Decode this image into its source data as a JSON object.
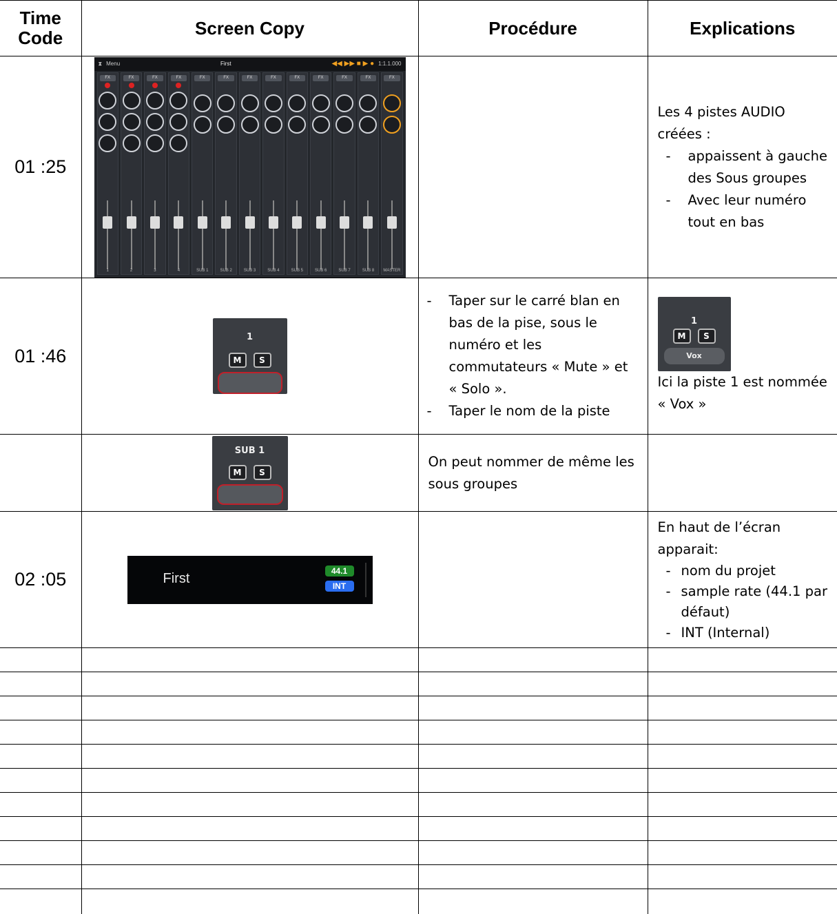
{
  "headers": {
    "time_code": "Time Code",
    "screen_copy": "Screen Copy",
    "procedure": "Procédure",
    "explications": "Explications"
  },
  "rows": [
    {
      "time": "01 :25",
      "screen": {
        "type": "mixer",
        "title": "First",
        "menu": "Menu",
        "counter": "1:1.1.000",
        "strip_labels": [
          "1",
          "2",
          "3",
          "4",
          "SUB 1",
          "SUB 2",
          "SUB 3",
          "SUB 4",
          "SUB 5",
          "SUB 6",
          "SUB 7",
          "SUB 8",
          "MASTER"
        ]
      },
      "procedure": [],
      "explication_intro": "Les 4 pistes AUDIO créées :",
      "explication_items": [
        "appaissent à gauche des Sous groupes",
        "Avec leur numéro tout en bas"
      ]
    },
    {
      "time": "01 :46",
      "screen": {
        "type": "track",
        "number": "1",
        "mute": "M",
        "solo": "S"
      },
      "procedure": [
        "Taper sur le carré blan en bas de la pise, sous le numéro et les commutateurs « Mute » et « Solo ».",
        "Taper le nom de la piste"
      ],
      "explication_image": {
        "number": "1",
        "mute": "M",
        "solo": "S",
        "name": "Vox"
      },
      "explication_text": "Ici la piste 1 est nommée « Vox »"
    },
    {
      "time": "",
      "screen": {
        "type": "track",
        "number": "SUB 1",
        "mute": "M",
        "solo": "S"
      },
      "procedure_text": "On peut nommer de même les sous groupes"
    },
    {
      "time": "02 :05",
      "screen": {
        "type": "titlebar",
        "project": "First",
        "rate": "44.1",
        "clock": "INT"
      },
      "explication_intro": "En haut de l’écran apparait:",
      "explication_items": [
        "nom du projet",
        "sample rate (44.1 par défaut)",
        "INT (Internal)"
      ]
    }
  ]
}
